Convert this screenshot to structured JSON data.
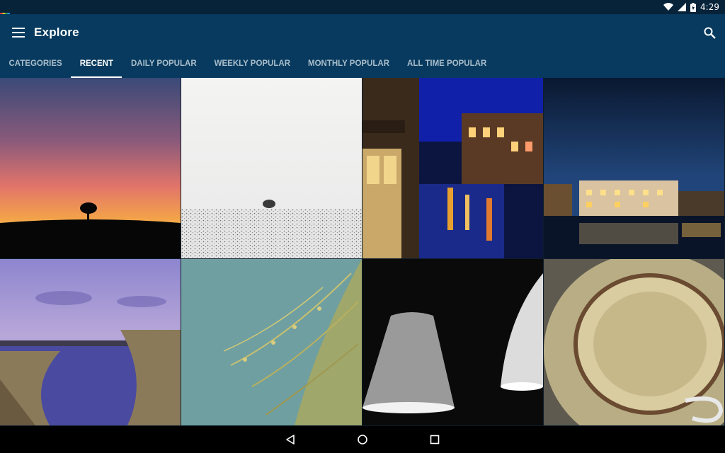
{
  "status_bar": {
    "time": "4:29",
    "icons": [
      "wifi-icon",
      "signal-icon",
      "battery-icon"
    ]
  },
  "app_bar": {
    "title": "Explore",
    "menu_icon": "menu-icon",
    "search_icon": "search-icon",
    "background": "#073a5e"
  },
  "tabs": [
    {
      "label": "CATEGORIES",
      "active": false
    },
    {
      "label": "RECENT",
      "active": true
    },
    {
      "label": "DAILY POPULAR",
      "active": false
    },
    {
      "label": "WEEKLY POPULAR",
      "active": false
    },
    {
      "label": "MONTHLY POPULAR",
      "active": false
    },
    {
      "label": "ALL TIME POPULAR",
      "active": false
    }
  ],
  "photos": [
    {
      "name": "photo-sunset-tree"
    },
    {
      "name": "photo-snowy-field-tree"
    },
    {
      "name": "photo-canal-night"
    },
    {
      "name": "photo-waterfront-night"
    },
    {
      "name": "photo-reeds-lake"
    },
    {
      "name": "photo-grass-water"
    },
    {
      "name": "photo-lamps"
    },
    {
      "name": "photo-cup-saucer"
    }
  ],
  "nav_bar": {
    "icons": [
      "back-icon",
      "home-icon",
      "recents-icon"
    ]
  }
}
